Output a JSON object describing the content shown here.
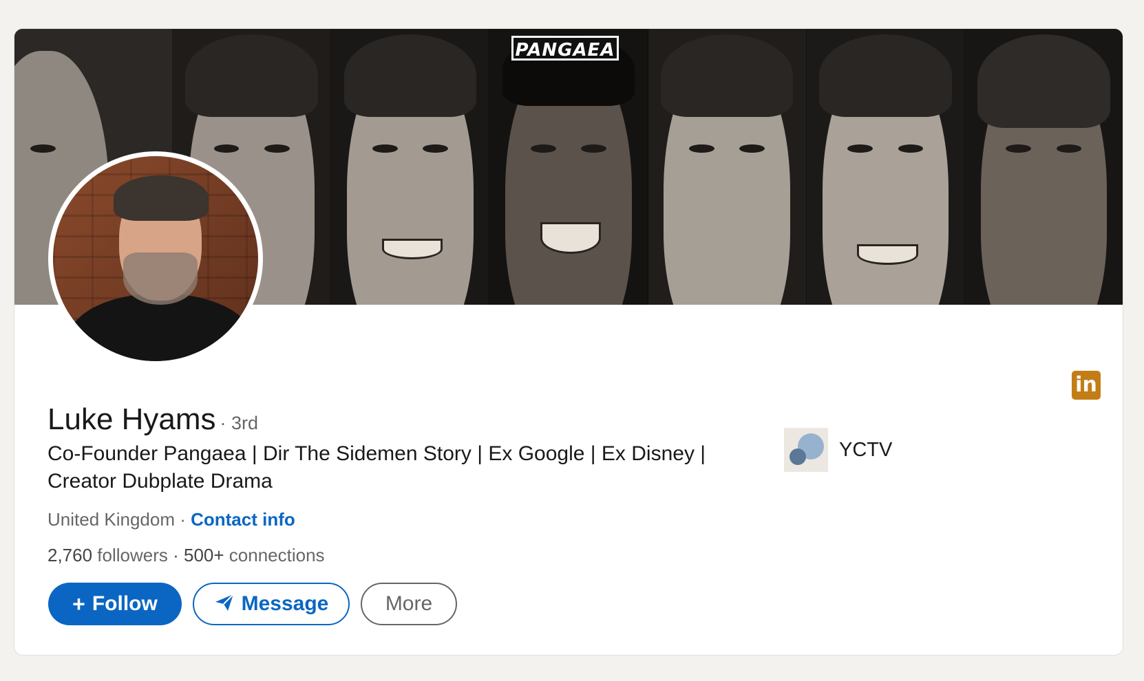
{
  "banner": {
    "logo_text": "PANGAEA"
  },
  "profile": {
    "name": "Luke Hyams",
    "degree": "· 3rd",
    "headline_line1": "Co-Founder Pangaea | Dir The Sidemen Story | Ex Google | Ex Disney |",
    "headline_line2": "Creator Dubplate Drama",
    "location": "United Kingdom · ",
    "contact_label": "Contact info",
    "followers_count": "2,760",
    "followers_label": " followers",
    "connections_count": " · 500+",
    "connections_label": " connections"
  },
  "actions": {
    "follow_label": "Follow",
    "follow_icon": "+",
    "message_label": "Message",
    "message_icon": "send-icon",
    "more_label": "More"
  },
  "company": {
    "name": "YCTV"
  },
  "colors": {
    "accent": "#0a66c2",
    "linkedin_badge": "#c37d16"
  }
}
